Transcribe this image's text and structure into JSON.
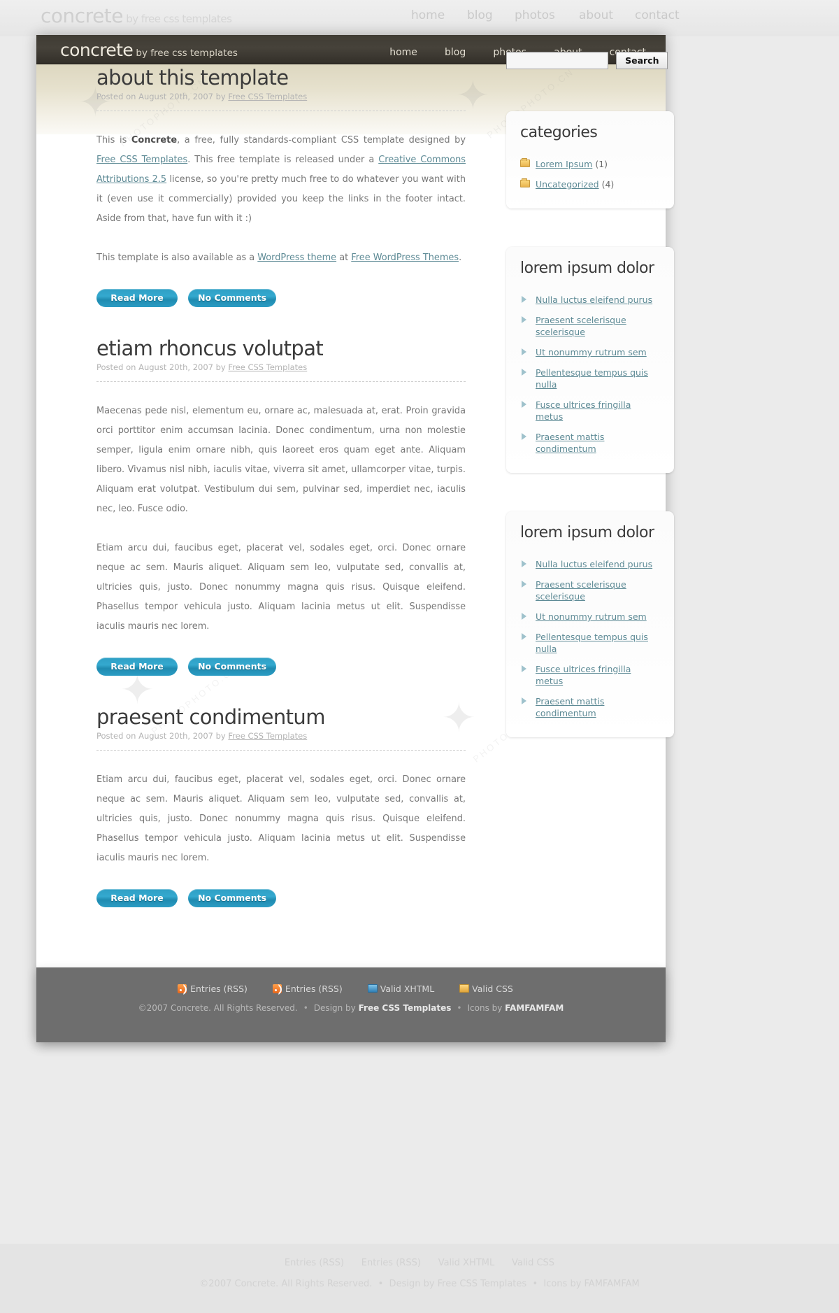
{
  "site": {
    "logo_main": "concrete",
    "logo_sub": " by free css templates",
    "nav": [
      {
        "label": "home"
      },
      {
        "label": "blog"
      },
      {
        "label": "photos"
      },
      {
        "label": "about"
      },
      {
        "label": "contact"
      }
    ]
  },
  "posts": [
    {
      "title": "about this template",
      "meta_prefix": "Posted on August 20th, 2007 by ",
      "meta_author": "Free CSS Templates",
      "p1_a": "This is ",
      "p1_strong": "Concrete",
      "p1_b": ", a free, fully standards-compliant CSS template designed by ",
      "p1_link1": "Free CSS Templates",
      "p1_c": ". This free template is released under a ",
      "p1_link2": "Creative Commons Attributions 2.5",
      "p1_d": " license, so you're pretty much free to do whatever you want with it (even use it commercially) provided you keep the links in the footer intact. Aside from that, have fun with it :)",
      "p2_a": "This template is also available as a ",
      "p2_link1": "WordPress theme",
      "p2_b": " at ",
      "p2_link2": "Free WordPress Themes",
      "p2_c": ".",
      "btn_read": "Read More",
      "btn_comments": "No Comments"
    },
    {
      "title": "etiam rhoncus volutpat",
      "meta_prefix": "Posted on August 20th, 2007 by ",
      "meta_author": "Free CSS Templates",
      "p1": "Maecenas pede nisl, elementum eu, ornare ac, malesuada at, erat. Proin gravida orci porttitor enim accumsan lacinia. Donec condimentum, urna non molestie semper, ligula enim ornare nibh, quis laoreet eros quam eget ante. Aliquam libero. Vivamus nisl nibh, iaculis vitae, viverra sit amet, ullamcorper vitae, turpis. Aliquam erat volutpat. Vestibulum dui sem, pulvinar sed, imperdiet nec, iaculis nec, leo. Fusce odio.",
      "p2": "Etiam arcu dui, faucibus eget, placerat vel, sodales eget, orci. Donec ornare neque ac sem. Mauris aliquet. Aliquam sem leo, vulputate sed, convallis at, ultricies quis, justo. Donec nonummy magna quis risus. Quisque eleifend. Phasellus tempor vehicula justo. Aliquam lacinia metus ut elit. Suspendisse iaculis mauris nec lorem.",
      "btn_read": "Read More",
      "btn_comments": "No Comments"
    },
    {
      "title": "praesent condimentum",
      "meta_prefix": "Posted on August 20th, 2007 by ",
      "meta_author": "Free CSS Templates",
      "p1": "Etiam arcu dui, faucibus eget, placerat vel, sodales eget, orci. Donec ornare neque ac sem. Mauris aliquet. Aliquam sem leo, vulputate sed, convallis at, ultricies quis, justo. Donec nonummy magna quis risus. Quisque eleifend. Phasellus tempor vehicula justo. Aliquam lacinia metus ut elit. Suspendisse iaculis mauris nec lorem.",
      "btn_read": "Read More",
      "btn_comments": "No Comments"
    }
  ],
  "sidebar": {
    "search": {
      "value": "",
      "placeholder": "",
      "button_label": "Search"
    },
    "categories": {
      "title": "categories",
      "items": [
        {
          "icon": "folder-icon",
          "label": "Lorem Ipsum",
          "count": "(1)"
        },
        {
          "icon": "folder-icon",
          "label": "Uncategorized",
          "count": "(4)"
        }
      ]
    },
    "widget1": {
      "title": "lorem ipsum dolor",
      "items": [
        {
          "label": "Nulla luctus eleifend purus"
        },
        {
          "label": "Praesent scelerisque scelerisque"
        },
        {
          "label": "Ut nonummy rutrum sem"
        },
        {
          "label": "Pellentesque tempus quis nulla"
        },
        {
          "label": "Fusce ultrices fringilla metus"
        },
        {
          "label": "Praesent mattis condimentum"
        }
      ]
    },
    "widget2": {
      "title": "lorem ipsum dolor",
      "items": [
        {
          "label": "Nulla luctus eleifend purus"
        },
        {
          "label": "Praesent scelerisque scelerisque"
        },
        {
          "label": "Ut nonummy rutrum sem"
        },
        {
          "label": "Pellentesque tempus quis nulla"
        },
        {
          "label": "Fusce ultrices fringilla metus"
        },
        {
          "label": "Praesent mattis condimentum"
        }
      ]
    }
  },
  "footer": {
    "links": [
      {
        "icon": "rss-icon",
        "label": "Entries (RSS)"
      },
      {
        "icon": "rss-icon",
        "label": "Entries (RSS)"
      },
      {
        "icon": "xhtml-icon",
        "label": "Valid XHTML"
      },
      {
        "icon": "css-icon",
        "label": "Valid CSS"
      }
    ],
    "copyright": "©2007 Concrete. All Rights Reserved.",
    "dot1": "•",
    "design_prefix": "Design by ",
    "design_by": "Free CSS Templates",
    "dot2": "•",
    "icons_prefix": "Icons by ",
    "icons_by": "FAMFAMFAM"
  },
  "colors": {
    "header_bg": "#3f3c34",
    "accent_link": "#5d8a95",
    "button_blue": "#2f9fc4",
    "footer_bg": "#6e6e6e"
  }
}
